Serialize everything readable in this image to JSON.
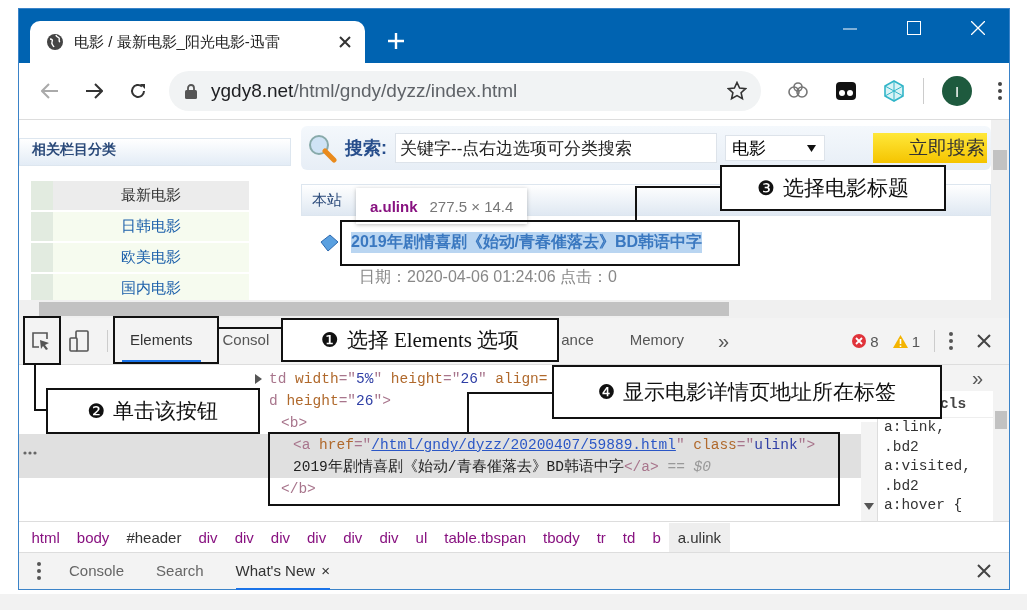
{
  "browser": {
    "tab_title": "电影 / 最新电影_阳光电影-迅雷",
    "url_host": "ygdy8.net",
    "url_path": "/html/gndy/dyzz/index.html",
    "avatar": "I"
  },
  "page": {
    "sidebar": {
      "heading": "相关栏目分类",
      "items": [
        {
          "label": "最新电影",
          "selected": true
        },
        {
          "label": "日韩电影",
          "selected": false
        },
        {
          "label": "欧美电影",
          "selected": false
        },
        {
          "label": "国内电影",
          "selected": false
        }
      ]
    },
    "search": {
      "label": "搜索:",
      "value": "关键字--点右边选项可分类搜索",
      "category": "电影",
      "button": "立即搜索"
    },
    "section_tab": "本站",
    "tooltip": {
      "selector": "a.ulink",
      "size": "277.5 × 14.4"
    },
    "movie_title": "2019年剧情喜剧《始动/青春催落去》BD韩语中字",
    "movie_meta": "日期：2020-04-06 01:24:06 点击：0"
  },
  "devtools": {
    "tabs": [
      {
        "label": "Elements",
        "selected": true
      },
      {
        "label": "Consol",
        "selected": false
      },
      {
        "label": "ance",
        "selected": false
      },
      {
        "label": "Memory",
        "selected": false
      }
    ],
    "more": "»",
    "errors": "8",
    "warnings": "1",
    "nodes": [
      {
        "expanded": false,
        "lines": [
          [
            {
              "kind": "tag",
              "text": "td "
            },
            {
              "kind": "attr",
              "text": "width"
            },
            {
              "kind": "tag",
              "text": "=\""
            },
            {
              "kind": "value",
              "text": "5%"
            },
            {
              "kind": "tag",
              "text": "\" "
            },
            {
              "kind": "attr",
              "text": "height"
            },
            {
              "kind": "tag",
              "text": "=\""
            },
            {
              "kind": "value",
              "text": "26"
            },
            {
              "kind": "tag",
              "text": "\" "
            },
            {
              "kind": "attr",
              "text": "align="
            }
          ]
        ]
      },
      {
        "lines": [
          [
            {
              "kind": "tag",
              "text": "d "
            },
            {
              "kind": "attr",
              "text": "height"
            },
            {
              "kind": "tag",
              "text": "=\""
            },
            {
              "kind": "value",
              "text": "26"
            },
            {
              "kind": "tag",
              "text": "\">"
            }
          ]
        ],
        "children": [
          {
            "lines": [
              [
                {
                  "kind": "tag",
                  "text": "<b>"
                }
              ]
            ],
            "children": [
              {
                "selected": true,
                "lines": [
                  [
                    {
                      "kind": "tag",
                      "text": "<a "
                    },
                    {
                      "kind": "attr",
                      "text": "href"
                    },
                    {
                      "kind": "tag",
                      "text": "=\""
                    },
                    {
                      "kind": "link",
                      "text": "/html/gndy/dyzz/20200407/59889.html"
                    },
                    {
                      "kind": "tag",
                      "text": "\" "
                    },
                    {
                      "kind": "attr",
                      "text": "class"
                    },
                    {
                      "kind": "tag",
                      "text": "=\""
                    },
                    {
                      "kind": "value",
                      "text": "ulink"
                    },
                    {
                      "kind": "tag",
                      "text": "\">"
                    }
                  ],
                  [
                    {
                      "kind": "text",
                      "text": "2019年剧情喜剧《始动/青春催落去》BD韩语中字"
                    },
                    {
                      "kind": "tag",
                      "text": "</a>"
                    },
                    {
                      "kind": "comment",
                      "text": " == $0"
                    }
                  ]
                ]
              }
            ],
            "close": "</b>"
          }
        ]
      }
    ],
    "styles_more": "»",
    "styles_cls": "cls",
    "styles": [
      "a:link,",
      ".bd2",
      "a:visited,",
      ".bd2",
      "a:hover {"
    ],
    "breadcrumbs": [
      {
        "text": "html",
        "kind": "tag",
        "selected": false
      },
      {
        "text": "body",
        "kind": "tag",
        "selected": false
      },
      {
        "text": "#header",
        "kind": "id",
        "selected": false
      },
      {
        "text": "div",
        "kind": "tag",
        "selected": false
      },
      {
        "text": "div",
        "kind": "tag",
        "selected": false
      },
      {
        "text": "div",
        "kind": "tag",
        "selected": false
      },
      {
        "text": "div",
        "kind": "tag",
        "selected": false
      },
      {
        "text": "div",
        "kind": "tag",
        "selected": false
      },
      {
        "text": "div",
        "kind": "tag",
        "selected": false
      },
      {
        "text": "ul",
        "kind": "tag",
        "selected": false
      },
      {
        "text": "table.tbspan",
        "kind": "tag",
        "selected": false
      },
      {
        "text": "tbody",
        "kind": "tag",
        "selected": false
      },
      {
        "text": "tr",
        "kind": "tag",
        "selected": false
      },
      {
        "text": "td",
        "kind": "tag",
        "selected": false
      },
      {
        "text": "b",
        "kind": "tag",
        "selected": false
      },
      {
        "text": "a.ulink",
        "kind": "tag",
        "selected": true
      }
    ],
    "drawer_tabs": [
      {
        "label": "Console",
        "selected": false
      },
      {
        "label": "Search",
        "selected": false
      },
      {
        "label": "What's New",
        "selected": true
      }
    ],
    "drawer_close": "×"
  },
  "callouts": [
    {
      "number": "❶",
      "text": "选择 Elements 选项"
    },
    {
      "number": "❷",
      "text": "单击该按钮"
    },
    {
      "number": "❸",
      "text": "选择电影标题"
    },
    {
      "number": "❹",
      "text": "显示电影详情页地址所在标签"
    }
  ]
}
